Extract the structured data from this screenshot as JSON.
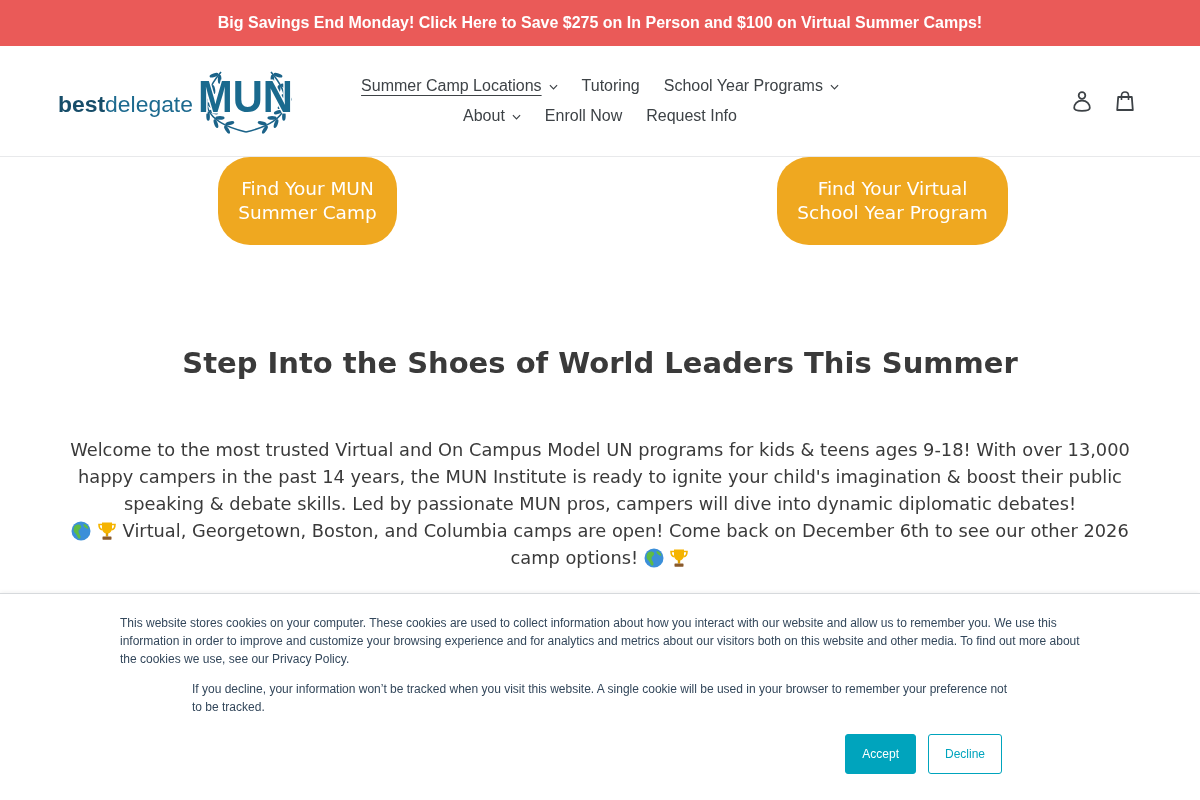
{
  "promo_banner": {
    "text": "Big Savings End Monday! Click Here to Save $275 on In Person and $100 on Virtual Summer Camps!"
  },
  "header": {
    "logo": {
      "prefix": "best",
      "name": "delegate",
      "mark": "MUN"
    },
    "nav": [
      {
        "label": "Summer Camp Locations",
        "dropdown": true,
        "selected": true
      },
      {
        "label": "Tutoring",
        "dropdown": false,
        "selected": false
      },
      {
        "label": "School Year Programs",
        "dropdown": true,
        "selected": false
      },
      {
        "label": "About",
        "dropdown": true,
        "selected": false
      },
      {
        "label": "Enroll Now",
        "dropdown": false,
        "selected": false
      },
      {
        "label": "Request Info",
        "dropdown": false,
        "selected": false
      }
    ]
  },
  "cta_buttons": [
    {
      "lines": [
        "Find Your MUN",
        "Summer Camp"
      ]
    },
    {
      "lines": [
        "Find Your Virtual",
        "School Year Program"
      ]
    }
  ],
  "headline": "Step Into the Shoes of World Leaders This Summer",
  "intro": "Welcome to the most trusted Virtual and On Campus Model UN programs for kids & teens ages 9-18! With over 13,000 happy campers in the past 14 years, the MUN Institute is ready to ignite your child's imagination & boost their public speaking & debate skills. Led by passionate MUN pros, campers will dive into dynamic diplomatic debates!",
  "announcement": "Virtual, Georgetown, Boston, and Columbia camps are open! Come back on December 6th to see our other 2026 camp options!",
  "cookie_notice": {
    "message": "This website stores cookies on your computer. These cookies are used to collect information about how you interact with our website and allow us to remember you. We use this information in order to improve and customize your browsing experience and for analytics and metrics about our visitors both on this website and other media. To find out more about the cookies we use, see our Privacy Policy.",
    "decline_note": "If you decline, your information won’t be tracked when you visit this website. A single cookie will be used in your browser to remember your preference not to be tracked.",
    "buttons": [
      {
        "label": "Accept",
        "kind": "primary"
      },
      {
        "label": "Decline",
        "kind": "secondary"
      }
    ]
  }
}
